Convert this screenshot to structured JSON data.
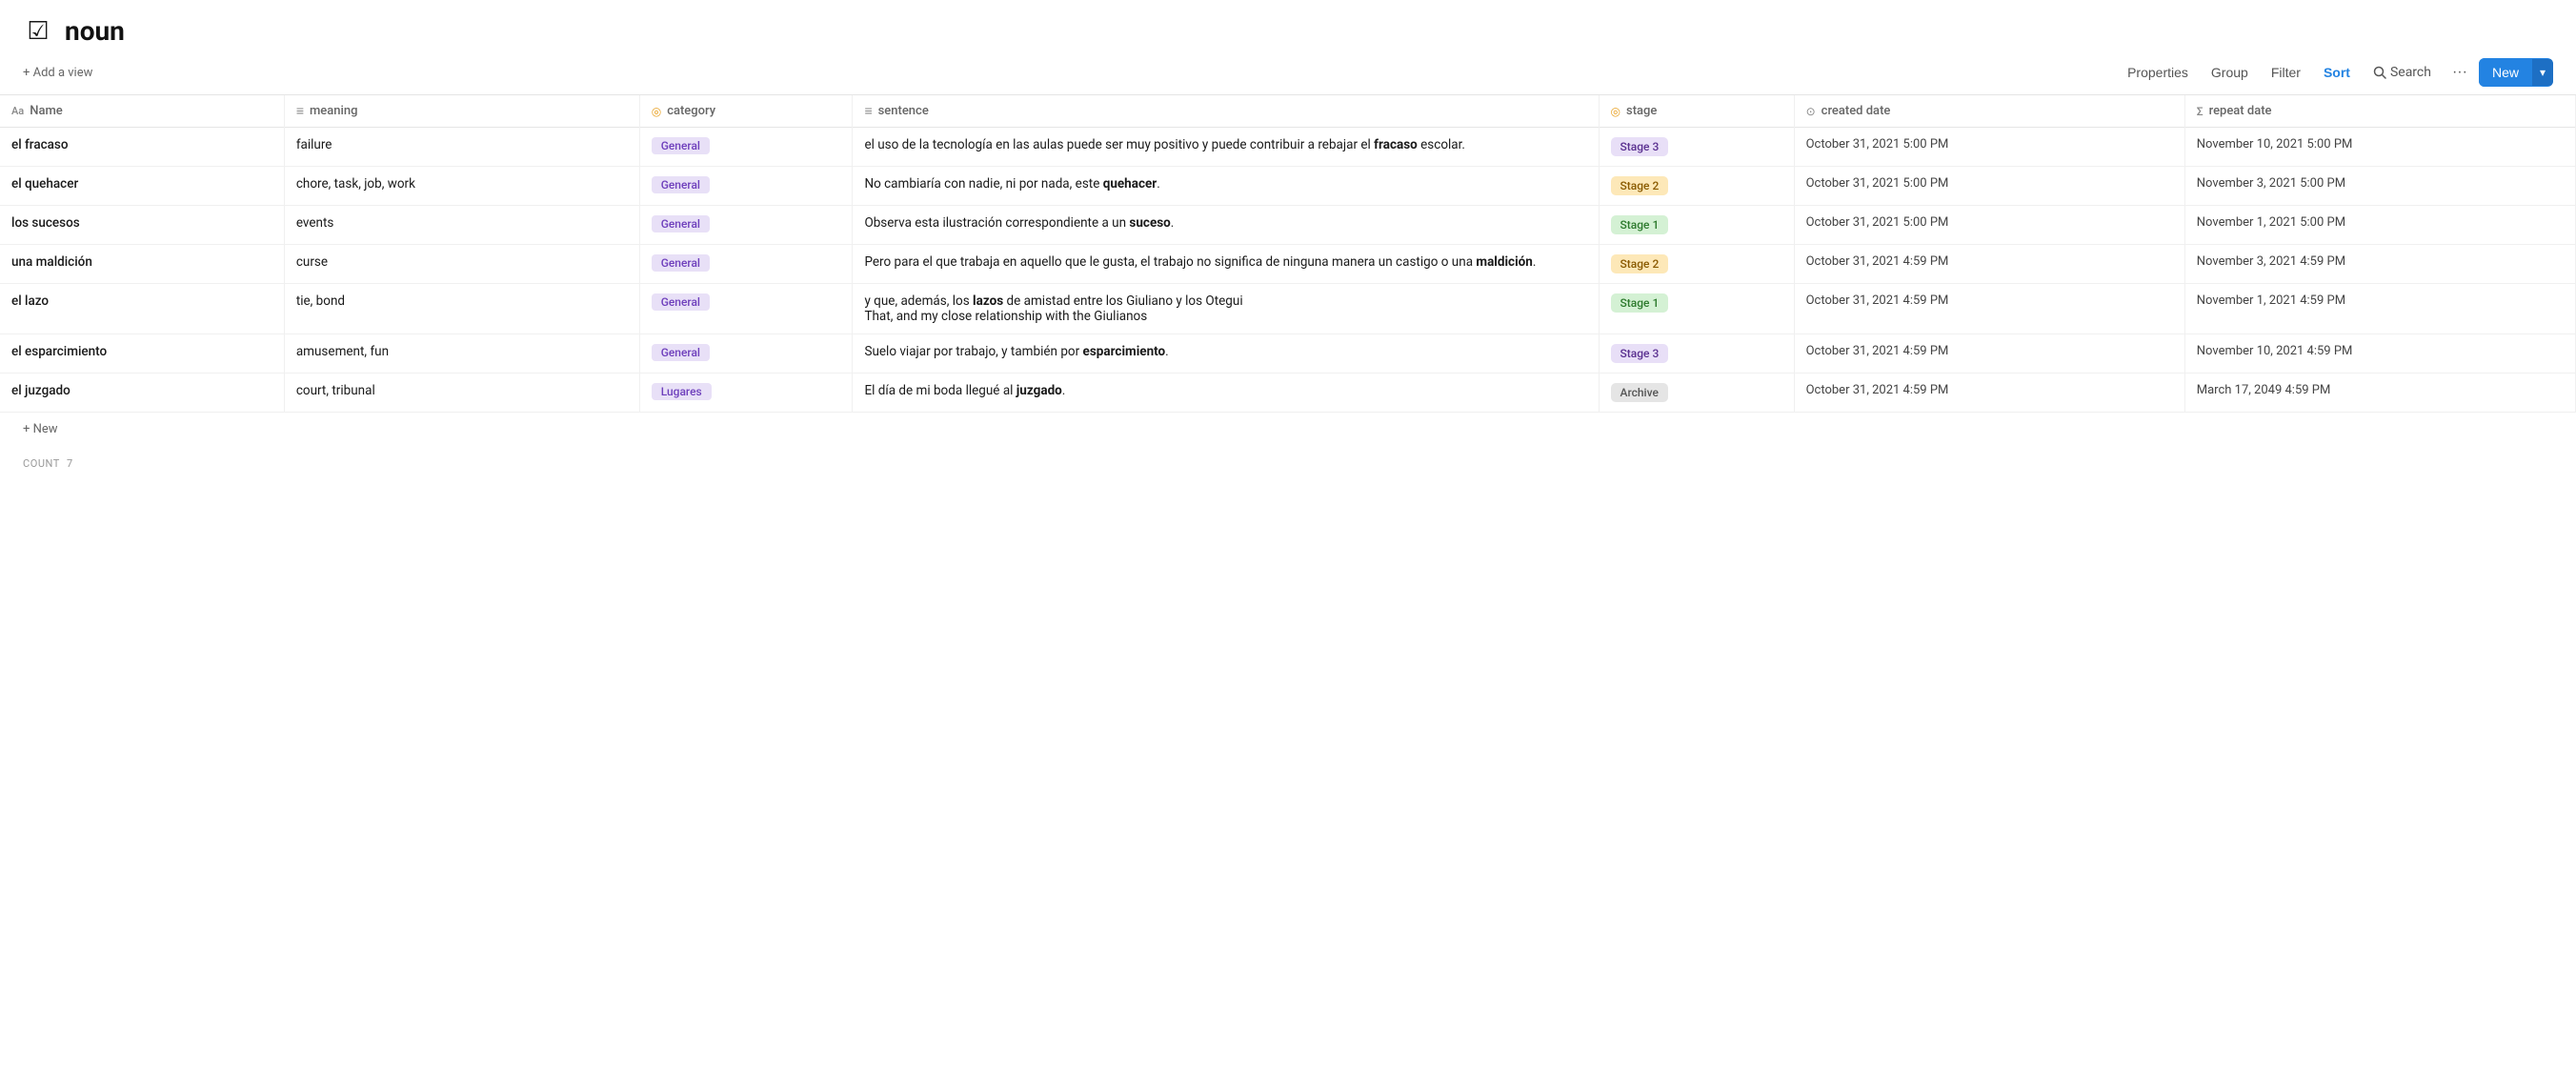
{
  "app": {
    "icon": "☑",
    "title": "noun"
  },
  "toolbar": {
    "add_view_label": "+ Add a view",
    "properties_label": "Properties",
    "group_label": "Group",
    "filter_label": "Filter",
    "sort_label": "Sort",
    "search_label": "Search",
    "more_label": "···",
    "new_label": "New",
    "chevron": "▾"
  },
  "columns": [
    {
      "id": "name",
      "icon": "Aa",
      "label": "Name"
    },
    {
      "id": "meaning",
      "icon": "≡",
      "label": "meaning"
    },
    {
      "id": "category",
      "icon": "◎",
      "label": "category"
    },
    {
      "id": "sentence",
      "icon": "≡",
      "label": "sentence"
    },
    {
      "id": "stage",
      "icon": "◎",
      "label": "stage"
    },
    {
      "id": "created_date",
      "icon": "⊙",
      "label": "created date"
    },
    {
      "id": "repeat_date",
      "icon": "Σ",
      "label": "repeat date"
    }
  ],
  "rows": [
    {
      "name": "el fracaso",
      "meaning": "failure",
      "category": "General",
      "category_class": "badge-general",
      "sentence_html": "el uso de la tecnología en las aulas puede ser muy positivo y puede contribuir a rebajar el <b>fracaso</b> escolar.",
      "stage": "Stage 3",
      "stage_class": "stage-3",
      "created_date": "October 31, 2021 5:00 PM",
      "repeat_date": "November 10, 2021 5:00 PM"
    },
    {
      "name": "el quehacer",
      "meaning": "chore, task, job, work",
      "category": "General",
      "category_class": "badge-general",
      "sentence_html": "No cambiaría con nadie, ni por nada, este <b>quehacer</b>.",
      "stage": "Stage 2",
      "stage_class": "stage-2",
      "created_date": "October 31, 2021 5:00 PM",
      "repeat_date": "November 3, 2021 5:00 PM"
    },
    {
      "name": "los sucesos",
      "meaning": "events",
      "category": "General",
      "category_class": "badge-general",
      "sentence_html": "Observa esta ilustración correspondiente a un <b>suceso</b>.",
      "stage": "Stage 1",
      "stage_class": "stage-1",
      "created_date": "October 31, 2021 5:00 PM",
      "repeat_date": "November 1, 2021 5:00 PM"
    },
    {
      "name": "una maldición",
      "meaning": "curse",
      "category": "General",
      "category_class": "badge-general",
      "sentence_html": "Pero para el que trabaja en aquello que le gusta, el trabajo no significa de ninguna manera un castigo o una <b>maldición</b>.",
      "stage": "Stage 2",
      "stage_class": "stage-2",
      "created_date": "October 31, 2021 4:59 PM",
      "repeat_date": "November 3, 2021 4:59 PM"
    },
    {
      "name": "el lazo",
      "meaning": "tie, bond",
      "category": "General",
      "category_class": "badge-general",
      "sentence_html": "y que, además, los <b>lazos</b> de amistad entre los Giuliano y los Otegui\nThat, and my close relationship with the Giulianos",
      "stage": "Stage 1",
      "stage_class": "stage-1",
      "created_date": "October 31, 2021 4:59 PM",
      "repeat_date": "November 1, 2021 4:59 PM"
    },
    {
      "name": "el esparcimiento",
      "meaning": "amusement, fun",
      "category": "General",
      "category_class": "badge-general",
      "sentence_html": "Suelo viajar por trabajo, y también por <b>esparcimiento</b>.",
      "stage": "Stage 3",
      "stage_class": "stage-3",
      "created_date": "October 31, 2021 4:59 PM",
      "repeat_date": "November 10, 2021 4:59 PM"
    },
    {
      "name": "el juzgado",
      "meaning": "court, tribunal",
      "category": "Lugares",
      "category_class": "badge-lugares",
      "sentence_html": "El día de mi boda llegué al <b>juzgado</b>.",
      "stage": "Archive",
      "stage_class": "stage-archive",
      "created_date": "October 31, 2021 4:59 PM",
      "repeat_date": "March 17, 2049 4:59 PM"
    }
  ],
  "footer": {
    "count_label": "COUNT",
    "count_value": "7"
  },
  "add_row_label": "+ New"
}
